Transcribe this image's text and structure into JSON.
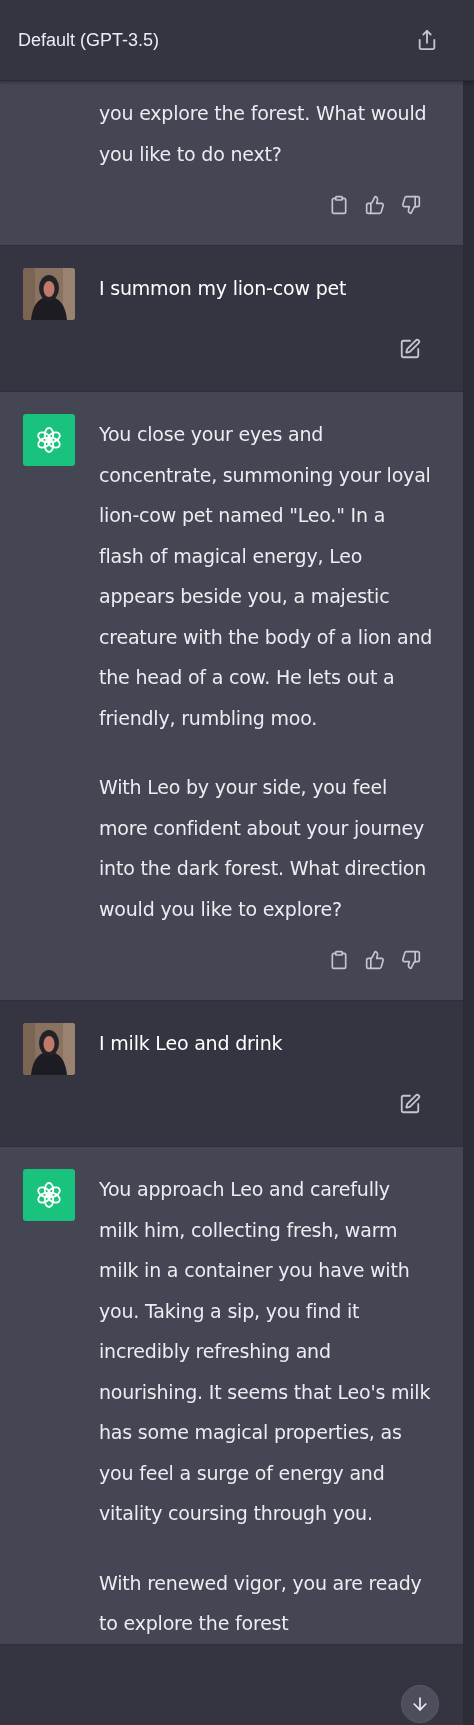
{
  "header": {
    "title": "Default (GPT-3.5)"
  },
  "messages": [
    {
      "kind": "assistant",
      "avatar": false,
      "actions": true,
      "paragraphs": [
        "you explore the forest. What would you like to do next?"
      ]
    },
    {
      "kind": "user",
      "avatar": true,
      "actions": true,
      "paragraphs": [
        "I summon my lion-cow pet"
      ]
    },
    {
      "kind": "assistant",
      "avatar": true,
      "actions": true,
      "paragraphs": [
        "You close your eyes and concentrate, summoning your loyal lion-cow pet named \"Leo.\" In a flash of magical energy, Leo appears beside you, a majestic creature with the body of a lion and the head of a cow. He lets out a friendly, rumbling moo.",
        "With Leo by your side, you feel more confident about your journey into the dark forest. What direction would you like to explore?"
      ]
    },
    {
      "kind": "user",
      "avatar": true,
      "actions": true,
      "paragraphs": [
        "I milk Leo and drink"
      ]
    },
    {
      "kind": "assistant",
      "avatar": true,
      "actions": false,
      "paragraphs": [
        "You approach Leo and carefully milk him, collecting fresh, warm milk in a container you have with you. Taking a sip, you find it incredibly refreshing and nourishing. It seems that Leo's milk has some magical properties, as you feel a surge of energy and vitality coursing through you.",
        "With renewed vigor, you are ready to explore the forest"
      ]
    }
  ]
}
